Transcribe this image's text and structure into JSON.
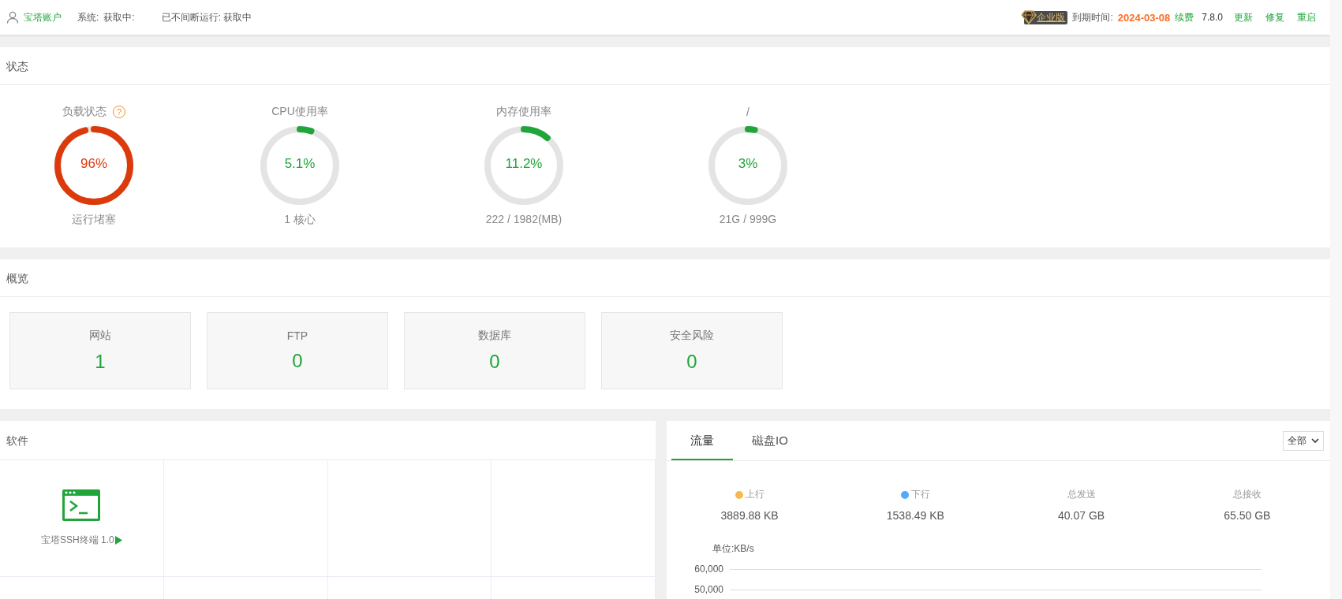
{
  "top_bar": {
    "account": "宝塔账户",
    "system_label": "系统:",
    "system_value": "获取中:",
    "uptime": "已不间断运行: 获取中",
    "edition": "企业版",
    "expiry_label": "到期时间:",
    "expiry_date": "2024-03-08",
    "renew": "续费",
    "version": "7.8.0",
    "actions": [
      "更新",
      "修复",
      "重启"
    ]
  },
  "status": {
    "title": "状态",
    "gauges": [
      {
        "title": "负载状态",
        "help": "?",
        "value": "96%",
        "level": 0.96,
        "color": "#dd3a0c",
        "caption": "运行堵塞"
      },
      {
        "title": "CPU使用率",
        "value": "5.1%",
        "level": 0.051,
        "color": "#20a53a",
        "caption": "1 核心"
      },
      {
        "title": "内存使用率",
        "value": "11.2%",
        "level": 0.112,
        "color": "#20a53a",
        "caption": "222 / 1982(MB)"
      },
      {
        "title": "/",
        "value": "3%",
        "level": 0.03,
        "color": "#20a53a",
        "caption": "21G / 999G"
      }
    ]
  },
  "overview": {
    "title": "概览",
    "cards": [
      {
        "label": "网站",
        "value": "1"
      },
      {
        "label": "FTP",
        "value": "0"
      },
      {
        "label": "数据库",
        "value": "0"
      },
      {
        "label": "安全风险",
        "value": "0"
      }
    ]
  },
  "software": {
    "title": "软件",
    "items": [
      {
        "name": "宝塔SSH终端 1.0"
      }
    ]
  },
  "traffic": {
    "tabs": [
      {
        "label": "流量",
        "selected": true
      },
      {
        "label": "磁盘IO",
        "selected": false
      }
    ],
    "select": "全部",
    "stats": [
      {
        "label": "上行",
        "color": "#f7b851",
        "value": "3889.88 KB"
      },
      {
        "label": "下行",
        "color": "#52a9ff",
        "value": "1538.49 KB"
      },
      {
        "label": "总发送",
        "value": "40.07 GB"
      },
      {
        "label": "总接收",
        "value": "65.50 GB"
      }
    ],
    "chart": {
      "unit": "单位:KB/s",
      "y_ticks": [
        "60,000",
        "50,000"
      ]
    }
  }
}
